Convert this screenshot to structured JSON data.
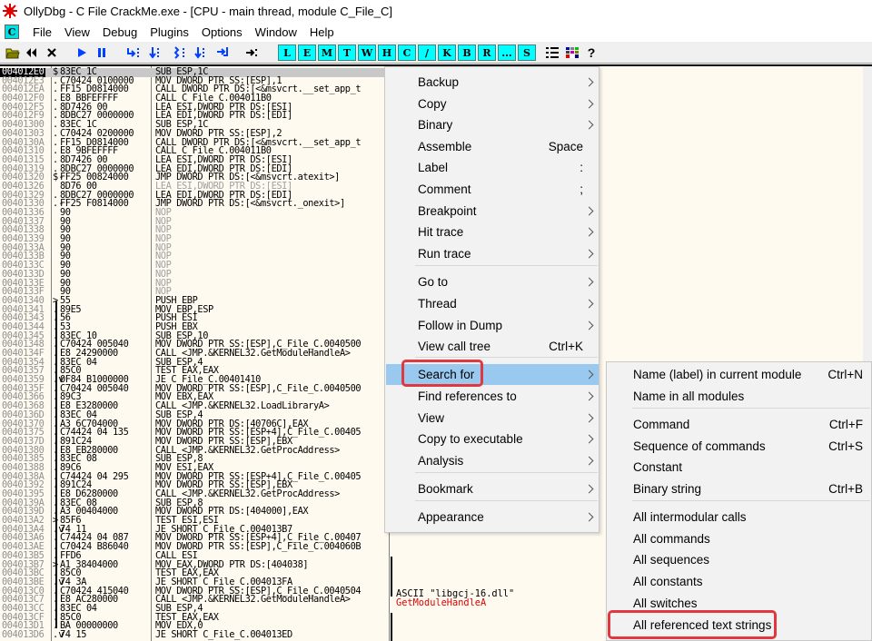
{
  "window": {
    "title": "OllyDbg - C File CrackMe.exe - [CPU - main thread, module C_File_C]"
  },
  "menubar": {
    "icon_letter": "C",
    "items": [
      "File",
      "View",
      "Debug",
      "Plugins",
      "Options",
      "Window",
      "Help"
    ]
  },
  "toolbar": {
    "buttons": [
      "open-icon",
      "restart-icon",
      "close-icon",
      "run-icon",
      "pause-icon",
      "step-into-icon",
      "step-over-icon",
      "trace-into-icon",
      "trace-over-icon",
      "execute-till-return-icon",
      "go-to-address-icon"
    ],
    "window_letters": [
      "L",
      "E",
      "M",
      "T",
      "W",
      "H",
      "C",
      "/",
      "K",
      "B",
      "R",
      "...",
      "S"
    ],
    "right_buttons": [
      "list-icon",
      "appearance-icon",
      "help-icon"
    ],
    "help_label": "?"
  },
  "disassembly": {
    "rows": [
      {
        "addr": "004012E0",
        "flow": "$",
        "hex": "83EC 1C",
        "asm": "SUB ESP,1C",
        "selected": true
      },
      {
        "addr": "004012E3",
        "flow": ".",
        "hex": "C70424 0100000",
        "asm": "MOV DWORD PTR SS:[ESP],1"
      },
      {
        "addr": "004012EA",
        "flow": ".",
        "hex": "FF15 D0814000",
        "asm": "CALL DWORD PTR DS:[<&msvcrt.__set_app_t"
      },
      {
        "addr": "004012F0",
        "flow": ".",
        "hex": "E8 BBFEFFFF",
        "asm": "CALL C_File_C.004011B0"
      },
      {
        "addr": "004012F5",
        "flow": ".",
        "hex": "8D7426 00",
        "asm": "LEA ESI,DWORD PTR DS:[ESI]"
      },
      {
        "addr": "004012F9",
        "flow": ".",
        "hex": "8DBC27 0000000",
        "asm": "LEA EDI,DWORD PTR DS:[EDI]"
      },
      {
        "addr": "00401300",
        "flow": ".",
        "hex": "83EC 1C",
        "asm": "SUB ESP,1C"
      },
      {
        "addr": "00401303",
        "flow": ".",
        "hex": "C70424 0200000",
        "asm": "MOV DWORD PTR SS:[ESP],2"
      },
      {
        "addr": "0040130A",
        "flow": ".",
        "hex": "FF15 D0814000",
        "asm": "CALL DWORD PTR DS:[<&msvcrt.__set_app_t"
      },
      {
        "addr": "00401310",
        "flow": ".",
        "hex": "E8 9BFEFFFF",
        "asm": "CALL C_File_C.004011B0"
      },
      {
        "addr": "00401315",
        "flow": ".",
        "hex": "8D7426 00",
        "asm": "LEA ESI,DWORD PTR DS:[ESI]"
      },
      {
        "addr": "00401319",
        "flow": ".",
        "hex": "8DBC27 0000000",
        "asm": "LEA EDI,DWORD PTR DS:[EDI]"
      },
      {
        "addr": "00401320",
        "flow": "$-",
        "hex": "FF25 00824000",
        "asm": "JMP DWORD PTR DS:[<&msvcrt.atexit>]"
      },
      {
        "addr": "00401326",
        "flow": "",
        "hex": "8D76 00",
        "asm": "LEA ESI,DWORD PTR DS:[ESI]",
        "grey": true
      },
      {
        "addr": "00401329",
        "flow": ".",
        "hex": "8DBC27 0000000",
        "asm": "LEA EDI,DWORD PTR DS:[EDI]"
      },
      {
        "addr": "00401330",
        "flow": ".-",
        "hex": "FF25 F0814000",
        "asm": "JMP DWORD PTR DS:[<&msvcrt._onexit>]"
      },
      {
        "addr": "00401336",
        "flow": "",
        "hex": "90",
        "asm": "NOP",
        "grey": true
      },
      {
        "addr": "00401337",
        "flow": "",
        "hex": "90",
        "asm": "NOP",
        "grey": true
      },
      {
        "addr": "00401338",
        "flow": "",
        "hex": "90",
        "asm": "NOP",
        "grey": true
      },
      {
        "addr": "00401339",
        "flow": "",
        "hex": "90",
        "asm": "NOP",
        "grey": true
      },
      {
        "addr": "0040133A",
        "flow": "",
        "hex": "90",
        "asm": "NOP",
        "grey": true
      },
      {
        "addr": "0040133B",
        "flow": "",
        "hex": "90",
        "asm": "NOP",
        "grey": true
      },
      {
        "addr": "0040133C",
        "flow": "",
        "hex": "90",
        "asm": "NOP",
        "grey": true
      },
      {
        "addr": "0040133D",
        "flow": "",
        "hex": "90",
        "asm": "NOP",
        "grey": true
      },
      {
        "addr": "0040133E",
        "flow": "",
        "hex": "90",
        "asm": "NOP",
        "grey": true
      },
      {
        "addr": "0040133F",
        "flow": "",
        "hex": "90",
        "asm": "NOP",
        "grey": true
      },
      {
        "addr": "00401340",
        "flow": ">",
        "hex": "55",
        "asm": "PUSH EBP"
      },
      {
        "addr": "00401341",
        "flow": ".",
        "hex": "89E5",
        "asm": "MOV EBP,ESP"
      },
      {
        "addr": "00401343",
        "flow": ".",
        "hex": "56",
        "asm": "PUSH ESI"
      },
      {
        "addr": "00401344",
        "flow": ".",
        "hex": "53",
        "asm": "PUSH EBX"
      },
      {
        "addr": "00401345",
        "flow": ".",
        "hex": "83EC 10",
        "asm": "SUB ESP,10"
      },
      {
        "addr": "00401348",
        "flow": ".",
        "hex": "C70424 005040",
        "asm": "MOV DWORD PTR SS:[ESP],C_File_C.0040500"
      },
      {
        "addr": "0040134F",
        "flow": ".",
        "hex": "E8 24290000",
        "asm": "CALL <JMP.&KERNEL32.GetModuleHandleA>"
      },
      {
        "addr": "00401354",
        "flow": ".",
        "hex": "83EC 04",
        "asm": "SUB ESP,4"
      },
      {
        "addr": "00401357",
        "flow": ".",
        "hex": "85C0",
        "asm": "TEST EAX,EAX"
      },
      {
        "addr": "00401359",
        "flow": ".v",
        "hex": "0F84 B1000000",
        "asm": "JE C_File_C.00401410"
      },
      {
        "addr": "0040135F",
        "flow": ".",
        "hex": "C70424 005040",
        "asm": "MOV DWORD PTR SS:[ESP],C_File_C.0040500"
      },
      {
        "addr": "00401366",
        "flow": ".",
        "hex": "89C3",
        "asm": "MOV EBX,EAX"
      },
      {
        "addr": "00401368",
        "flow": ".",
        "hex": "E8 E3280000",
        "asm": "CALL <JMP.&KERNEL32.LoadLibraryA>"
      },
      {
        "addr": "0040136D",
        "flow": ".",
        "hex": "83EC 04",
        "asm": "SUB ESP,4"
      },
      {
        "addr": "00401370",
        "flow": ".",
        "hex": "A3 6C704000",
        "asm": "MOV DWORD PTR DS:[40706C],EAX"
      },
      {
        "addr": "00401375",
        "flow": ".",
        "hex": "C74424 04 135",
        "asm": "MOV DWORD PTR SS:[ESP+4],C_File_C.00405"
      },
      {
        "addr": "0040137D",
        "flow": ".",
        "hex": "891C24",
        "asm": "MOV DWORD PTR SS:[ESP],EBX"
      },
      {
        "addr": "00401380",
        "flow": ".",
        "hex": "E8 EB280000",
        "asm": "CALL <JMP.&KERNEL32.GetProcAddress>"
      },
      {
        "addr": "00401385",
        "flow": ".",
        "hex": "83EC 08",
        "asm": "SUB ESP,8"
      },
      {
        "addr": "00401388",
        "flow": ".",
        "hex": "89C6",
        "asm": "MOV ESI,EAX"
      },
      {
        "addr": "0040138A",
        "flow": ".",
        "hex": "C74424 04 295",
        "asm": "MOV DWORD PTR SS:[ESP+4],C_File_C.00405"
      },
      {
        "addr": "00401392",
        "flow": ".",
        "hex": "891C24",
        "asm": "MOV DWORD PTR SS:[ESP],EBX"
      },
      {
        "addr": "00401395",
        "flow": ".",
        "hex": "E8 D6280000",
        "asm": "CALL <JMP.&KERNEL32.GetProcAddress>"
      },
      {
        "addr": "0040139A",
        "flow": ".",
        "hex": "83EC 08",
        "asm": "SUB ESP,8"
      },
      {
        "addr": "0040139D",
        "flow": ".",
        "hex": "A3 00404000",
        "asm": "MOV DWORD PTR DS:[404000],EAX"
      },
      {
        "addr": "004013A2",
        "flow": ">",
        "hex": "85F6",
        "asm": "TEST ESI,ESI"
      },
      {
        "addr": "004013A4",
        "flow": ".v",
        "hex": "74 11",
        "asm": "JE SHORT C_File_C.004013B7"
      },
      {
        "addr": "004013A6",
        "flow": ".",
        "hex": "C74424 04 087",
        "asm": "MOV DWORD PTR SS:[ESP+4],C_File_C.00407"
      },
      {
        "addr": "004013AE",
        "flow": ".",
        "hex": "C70424 B86040",
        "asm": "MOV DWORD PTR SS:[ESP],C_File_C.004060B"
      },
      {
        "addr": "004013B5",
        "flow": ".",
        "hex": "FFD6",
        "asm": "CALL ESI"
      },
      {
        "addr": "004013B7",
        "flow": ">",
        "hex": "A1 38404000",
        "asm": "MOV EAX,DWORD PTR DS:[404038]"
      },
      {
        "addr": "004013BC",
        "flow": ".",
        "hex": "85C0",
        "asm": "TEST EAX,EAX"
      },
      {
        "addr": "004013BE",
        "flow": ".v",
        "hex": "74 3A",
        "asm": "JE SHORT C_File_C.004013FA"
      },
      {
        "addr": "004013C0",
        "flow": ".",
        "hex": "C70424 415040",
        "asm": "MOV DWORD PTR SS:[ESP],C_File_C.0040504"
      },
      {
        "addr": "004013C7",
        "flow": ".",
        "hex": "E8 AC280000",
        "asm": "CALL <JMP.&KERNEL32.GetModuleHandleA>"
      },
      {
        "addr": "004013CC",
        "flow": ".",
        "hex": "83EC 04",
        "asm": "SUB ESP,4"
      },
      {
        "addr": "004013CF",
        "flow": ".",
        "hex": "85C0",
        "asm": "TEST EAX,EAX"
      },
      {
        "addr": "004013D1",
        "flow": ".",
        "hex": "BA 00000000",
        "asm": "MOV EDX,0"
      },
      {
        "addr": "004013D6",
        "flow": ".v",
        "hex": "74 15",
        "asm": "JE SHORT C_File_C.004013ED"
      }
    ],
    "comments": [
      {
        "text": "ASCII \"libgcj-16.dll\"",
        "color": "#000000"
      },
      {
        "text": "GetModuleHandleA",
        "color": "#e00000"
      }
    ]
  },
  "context_menu": {
    "items": [
      {
        "label": "Backup",
        "submenu": true
      },
      {
        "label": "Copy",
        "submenu": true
      },
      {
        "label": "Binary",
        "submenu": true
      },
      {
        "label": "Assemble",
        "shortcut": "Space"
      },
      {
        "label": "Label",
        "shortcut": ":"
      },
      {
        "label": "Comment",
        "shortcut": ";"
      },
      {
        "label": "Breakpoint",
        "submenu": true
      },
      {
        "label": "Hit trace",
        "submenu": true
      },
      {
        "label": "Run trace",
        "submenu": true
      },
      {
        "label": "Go to",
        "submenu": true
      },
      {
        "label": "Thread",
        "submenu": true
      },
      {
        "label": "Follow in Dump",
        "submenu": true
      },
      {
        "label": "View call tree",
        "shortcut": "Ctrl+K"
      },
      {
        "label": "Search for",
        "submenu": true,
        "highlighted": true
      },
      {
        "label": "Find references to",
        "submenu": true
      },
      {
        "label": "View",
        "submenu": true
      },
      {
        "label": "Copy to executable",
        "submenu": true
      },
      {
        "label": "Analysis",
        "submenu": true
      },
      {
        "label": "Bookmark",
        "submenu": true
      },
      {
        "label": "Appearance",
        "submenu": true
      }
    ]
  },
  "search_submenu": {
    "items": [
      {
        "label": "Name (label) in current module",
        "shortcut": "Ctrl+N"
      },
      {
        "label": "Name in all modules",
        "shortcut": ""
      },
      {
        "label": "Command",
        "shortcut": "Ctrl+F"
      },
      {
        "label": "Sequence of commands",
        "shortcut": "Ctrl+S"
      },
      {
        "label": "Constant",
        "shortcut": ""
      },
      {
        "label": "Binary string",
        "shortcut": "Ctrl+B"
      },
      {
        "label": "All intermodular calls",
        "shortcut": ""
      },
      {
        "label": "All commands",
        "shortcut": ""
      },
      {
        "label": "All sequences",
        "shortcut": ""
      },
      {
        "label": "All constants",
        "shortcut": ""
      },
      {
        "label": "All switches",
        "shortcut": ""
      },
      {
        "label": "All referenced text strings",
        "shortcut": "",
        "annotated": true
      }
    ]
  },
  "colors": {
    "highlight": "#99c9ef",
    "annotation_red": "#e0383e",
    "toolbar_cyan": "#00ffff",
    "pane_bg": "#fffaf0"
  }
}
